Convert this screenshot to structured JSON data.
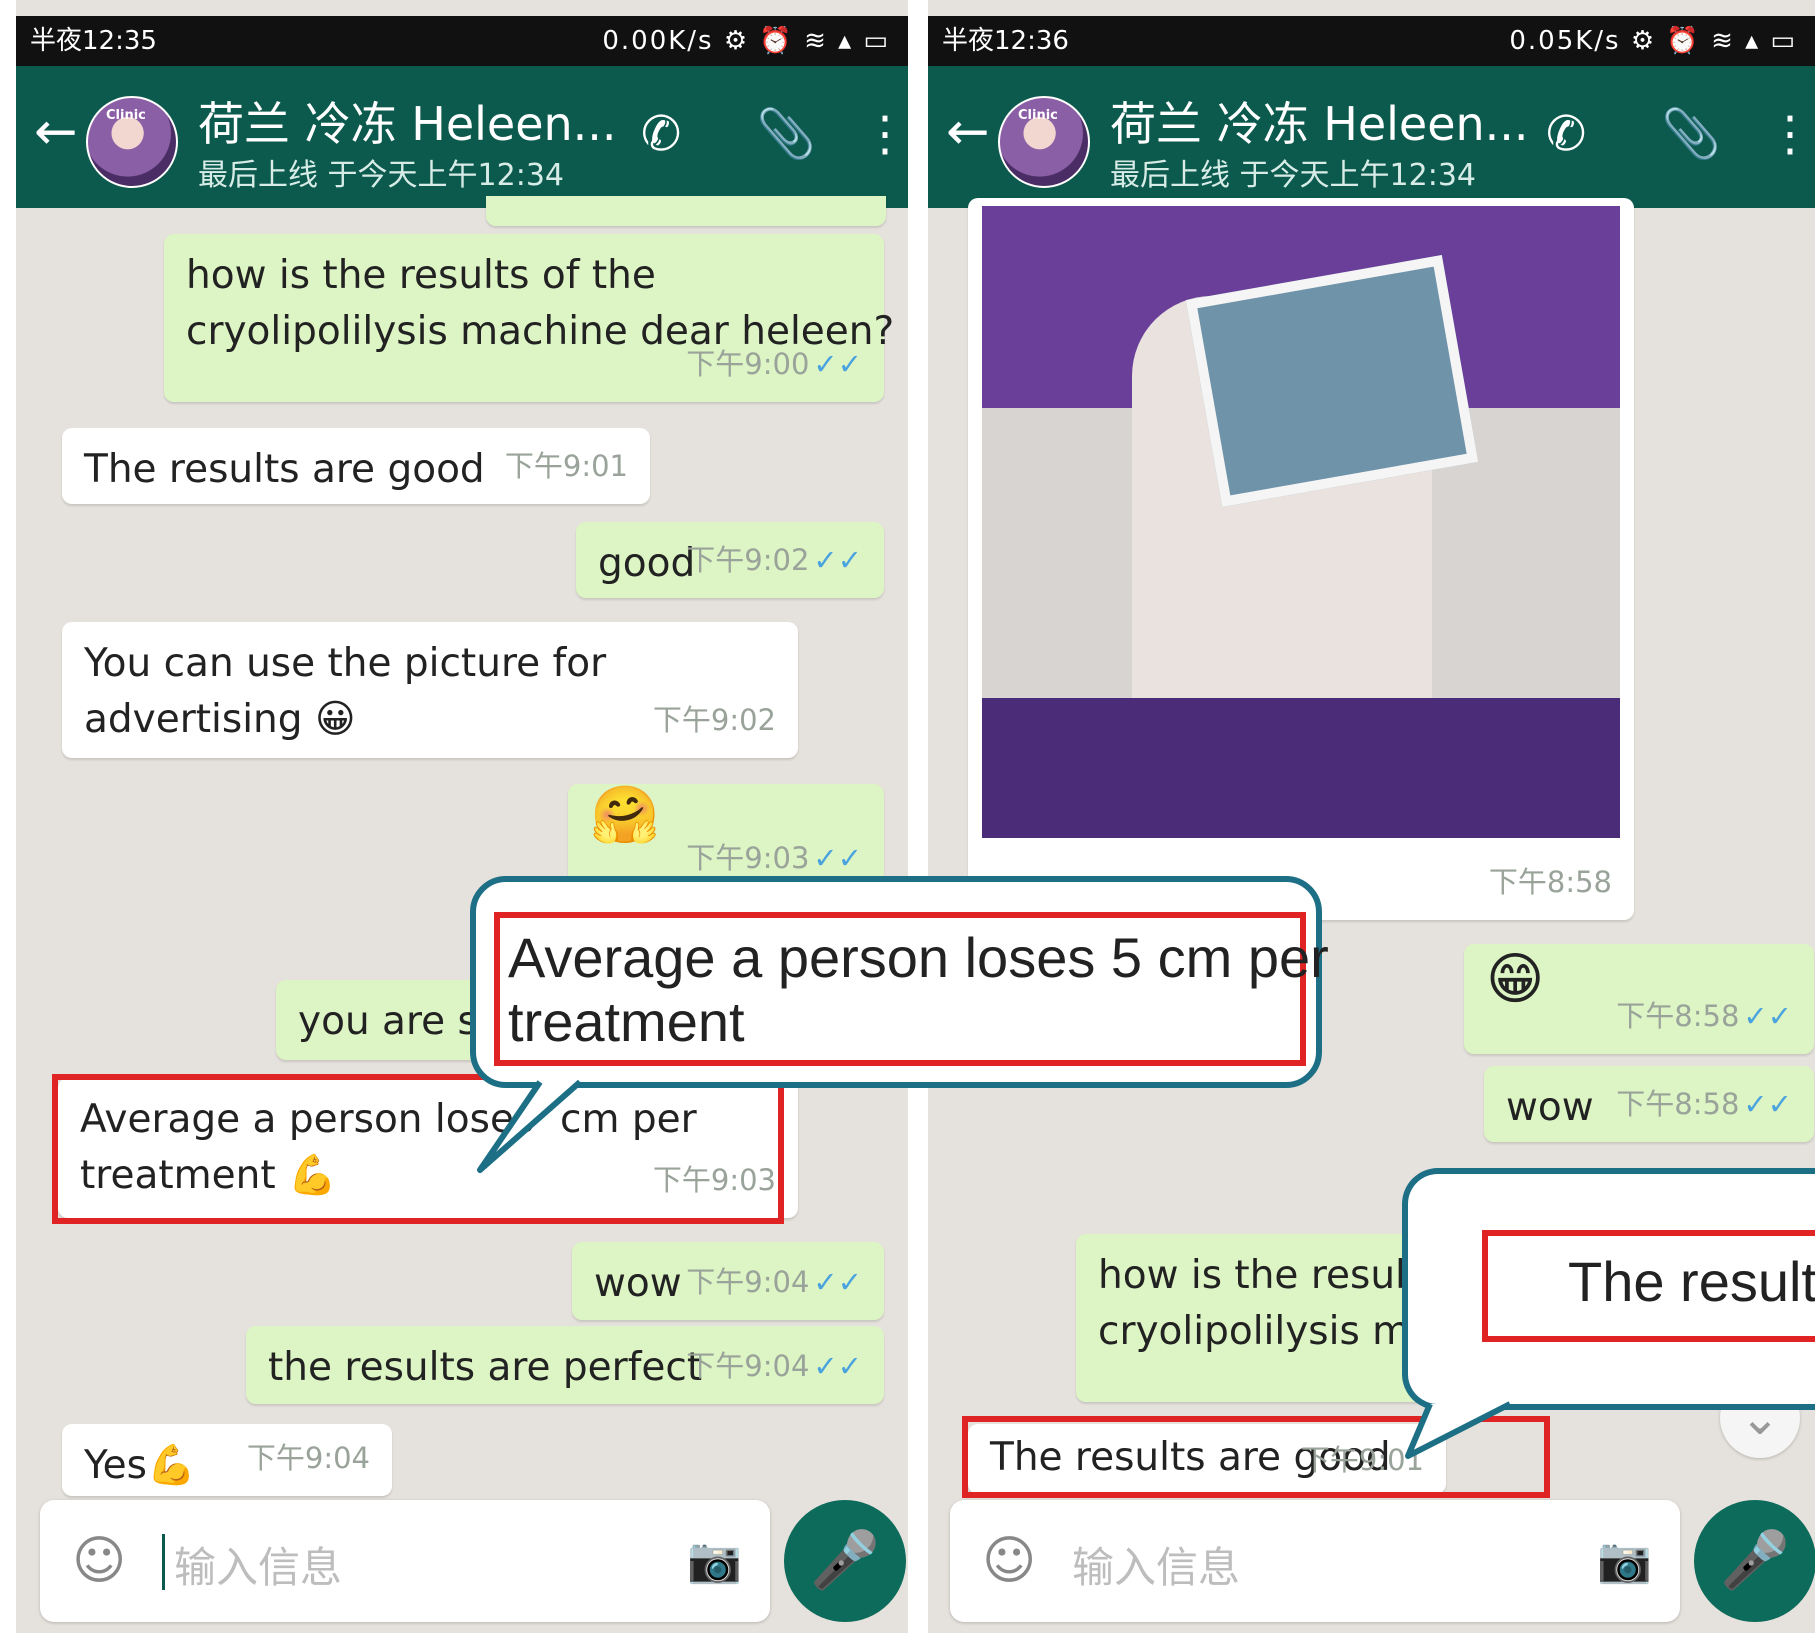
{
  "left": {
    "status": {
      "time": "半夜12:35",
      "system": "0.00K/s ⚙ ⏰ ≋ ▴ ▭"
    },
    "header": {
      "name": "荷兰 冷冻 Heleen...",
      "last_seen": "最后上线 于今天上午12:34"
    },
    "messages": [
      {
        "dir": "out",
        "lines": [
          "how is the results of the",
          "cryolipolilysis machine dear heleen?"
        ],
        "time": "下午9:00",
        "ticks": "✓✓"
      },
      {
        "dir": "in",
        "lines": [
          "The results are good"
        ],
        "time": "下午9:01"
      },
      {
        "dir": "out",
        "lines": [
          "good"
        ],
        "time": "下午9:02",
        "ticks": "✓✓"
      },
      {
        "dir": "in",
        "lines": [
          "You can use the picture for",
          "advertising 😀"
        ],
        "time": "下午9:02"
      },
      {
        "dir": "out",
        "lines": [
          "🤗"
        ],
        "time": "下午9:03",
        "ticks": "✓✓"
      },
      {
        "dir": "out",
        "lines": [
          "you are s"
        ],
        "time": ""
      },
      {
        "dir": "in",
        "lines": [
          "Average a person loses",
          "treatment 💪"
        ],
        "extra": "cm per",
        "time": "下午9:03"
      },
      {
        "dir": "out",
        "lines": [
          "wow"
        ],
        "time": "下午9:04",
        "ticks": "✓✓"
      },
      {
        "dir": "out",
        "lines": [
          "the results are perfect"
        ],
        "time": "下午9:04",
        "ticks": "✓✓"
      },
      {
        "dir": "in",
        "lines": [
          "Yes💪"
        ],
        "time": "下午9:04"
      }
    ],
    "input_placeholder": "输入信息"
  },
  "right": {
    "status": {
      "time": "半夜12:36",
      "system": "0.05K/s ⚙ ⏰ ≋ ▴ ▭"
    },
    "header": {
      "name": "荷兰 冷冻 Heleen...",
      "last_seen": "最后上线 于今天上午12:34"
    },
    "photo_time": "下午8:58",
    "messages": [
      {
        "dir": "out",
        "lines": [
          "😁"
        ],
        "time": "下午8:58",
        "ticks": "✓✓"
      },
      {
        "dir": "out",
        "lines": [
          "wow"
        ],
        "time": "下午8:58",
        "ticks": "✓✓"
      },
      {
        "dir": "out",
        "lines": [
          "how is the result",
          "cryolipolilysis ma"
        ],
        "time": ""
      },
      {
        "dir": "in",
        "lines": [
          "The results are good"
        ],
        "time": "下午9:01"
      }
    ],
    "input_placeholder": "输入信息"
  },
  "callouts": {
    "left": [
      "Average a person loses 5 cm per",
      "treatment"
    ],
    "right": "The results"
  },
  "icons": {
    "back": "←",
    "phone": "✆",
    "attach": "📎",
    "menu": "⋮",
    "smile": "☺",
    "camera": "📷",
    "mic": "🎤",
    "scroll_down": "⌄"
  },
  "colors": {
    "header": "#0c5a4e",
    "outgoing": "#ddf5c4",
    "highlight": "#e02424",
    "callout_border": "#1d6f85"
  }
}
